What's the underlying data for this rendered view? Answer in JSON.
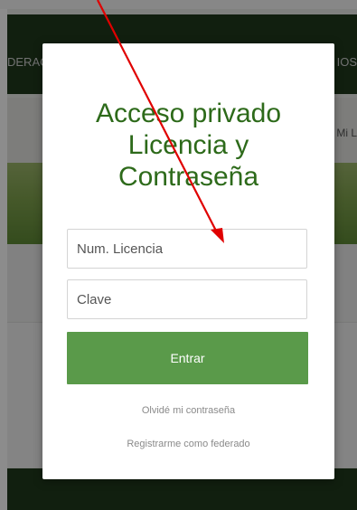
{
  "background": {
    "nav_left_text": "DERAC",
    "nav_right_text": "IOS",
    "banner_right_text": "Mi L"
  },
  "modal": {
    "title_line1": "Acceso privado",
    "title_line2": "Licencia y",
    "title_line3": "Contraseña",
    "license_placeholder": "Num. Licencia",
    "password_placeholder": "Clave",
    "submit_label": "Entrar",
    "forgot_link": "Olvidé mi contraseña",
    "register_link": "Registrarme como federado"
  },
  "colors": {
    "title": "#2d6a1a",
    "button": "#5a9a4a",
    "nav": "#1f3a1c",
    "arrow": "#e00000"
  }
}
